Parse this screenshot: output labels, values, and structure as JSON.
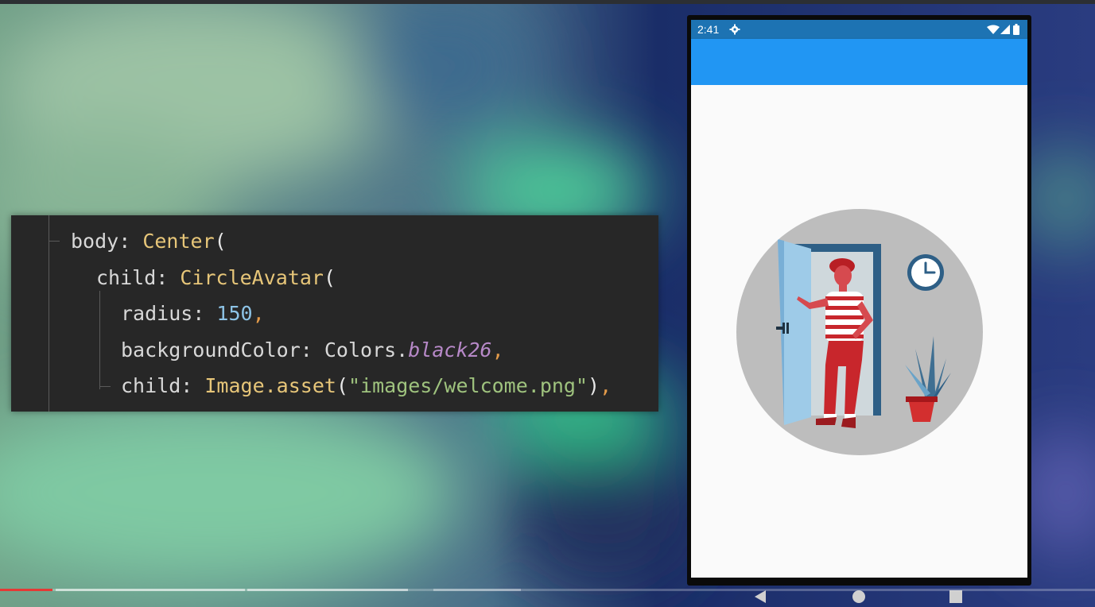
{
  "code": {
    "lines": {
      "l1": {
        "key": "body: ",
        "cls": "Center",
        "paren": "("
      },
      "l2": {
        "key": "child: ",
        "cls": "CircleAvatar",
        "paren": "("
      },
      "l3": {
        "key": "radius: ",
        "num": "150",
        "comma": ","
      },
      "l4": {
        "key": "backgroundColor: Colors.",
        "italic": "black26",
        "comma": ","
      },
      "l5": {
        "key": "child: ",
        "cls": "Image.asset",
        "paren_open": "(",
        "str": "\"images/welcome.png\"",
        "paren_close": ")",
        "comma": ","
      }
    }
  },
  "phone": {
    "status": {
      "time": "2:41"
    },
    "icons": [
      "gear-icon",
      "wifi-icon",
      "signal-icon",
      "battery-icon",
      "back-icon",
      "home-icon",
      "recents-icon",
      "clock-icon",
      "door-icon",
      "plant-icon"
    ],
    "colors": {
      "appbar": "#2196F3",
      "statusbar": "#1D73B3",
      "avatar_bg": "#BDBDBD",
      "scaffold": "#FAFAFA"
    }
  },
  "player": {
    "progress": 0.048
  }
}
